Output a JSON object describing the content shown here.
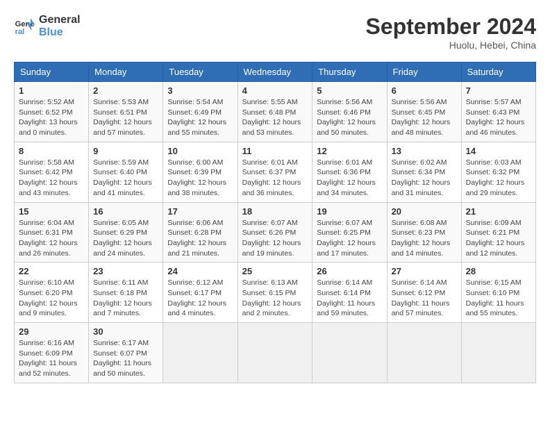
{
  "header": {
    "logo_line1": "General",
    "logo_line2": "Blue",
    "month": "September 2024",
    "location": "Huolu, Hebei, China"
  },
  "weekdays": [
    "Sunday",
    "Monday",
    "Tuesday",
    "Wednesday",
    "Thursday",
    "Friday",
    "Saturday"
  ],
  "weeks": [
    [
      {
        "day": "1",
        "detail": "Sunrise: 5:52 AM\nSunset: 6:52 PM\nDaylight: 13 hours\nand 0 minutes."
      },
      {
        "day": "2",
        "detail": "Sunrise: 5:53 AM\nSunset: 6:51 PM\nDaylight: 12 hours\nand 57 minutes."
      },
      {
        "day": "3",
        "detail": "Sunrise: 5:54 AM\nSunset: 6:49 PM\nDaylight: 12 hours\nand 55 minutes."
      },
      {
        "day": "4",
        "detail": "Sunrise: 5:55 AM\nSunset: 6:48 PM\nDaylight: 12 hours\nand 53 minutes."
      },
      {
        "day": "5",
        "detail": "Sunrise: 5:56 AM\nSunset: 6:46 PM\nDaylight: 12 hours\nand 50 minutes."
      },
      {
        "day": "6",
        "detail": "Sunrise: 5:56 AM\nSunset: 6:45 PM\nDaylight: 12 hours\nand 48 minutes."
      },
      {
        "day": "7",
        "detail": "Sunrise: 5:57 AM\nSunset: 6:43 PM\nDaylight: 12 hours\nand 46 minutes."
      }
    ],
    [
      {
        "day": "8",
        "detail": "Sunrise: 5:58 AM\nSunset: 6:42 PM\nDaylight: 12 hours\nand 43 minutes."
      },
      {
        "day": "9",
        "detail": "Sunrise: 5:59 AM\nSunset: 6:40 PM\nDaylight: 12 hours\nand 41 minutes."
      },
      {
        "day": "10",
        "detail": "Sunrise: 6:00 AM\nSunset: 6:39 PM\nDaylight: 12 hours\nand 38 minutes."
      },
      {
        "day": "11",
        "detail": "Sunrise: 6:01 AM\nSunset: 6:37 PM\nDaylight: 12 hours\nand 36 minutes."
      },
      {
        "day": "12",
        "detail": "Sunrise: 6:01 AM\nSunset: 6:36 PM\nDaylight: 12 hours\nand 34 minutes."
      },
      {
        "day": "13",
        "detail": "Sunrise: 6:02 AM\nSunset: 6:34 PM\nDaylight: 12 hours\nand 31 minutes."
      },
      {
        "day": "14",
        "detail": "Sunrise: 6:03 AM\nSunset: 6:32 PM\nDaylight: 12 hours\nand 29 minutes."
      }
    ],
    [
      {
        "day": "15",
        "detail": "Sunrise: 6:04 AM\nSunset: 6:31 PM\nDaylight: 12 hours\nand 26 minutes."
      },
      {
        "day": "16",
        "detail": "Sunrise: 6:05 AM\nSunset: 6:29 PM\nDaylight: 12 hours\nand 24 minutes."
      },
      {
        "day": "17",
        "detail": "Sunrise: 6:06 AM\nSunset: 6:28 PM\nDaylight: 12 hours\nand 21 minutes."
      },
      {
        "day": "18",
        "detail": "Sunrise: 6:07 AM\nSunset: 6:26 PM\nDaylight: 12 hours\nand 19 minutes."
      },
      {
        "day": "19",
        "detail": "Sunrise: 6:07 AM\nSunset: 6:25 PM\nDaylight: 12 hours\nand 17 minutes."
      },
      {
        "day": "20",
        "detail": "Sunrise: 6:08 AM\nSunset: 6:23 PM\nDaylight: 12 hours\nand 14 minutes."
      },
      {
        "day": "21",
        "detail": "Sunrise: 6:09 AM\nSunset: 6:21 PM\nDaylight: 12 hours\nand 12 minutes."
      }
    ],
    [
      {
        "day": "22",
        "detail": "Sunrise: 6:10 AM\nSunset: 6:20 PM\nDaylight: 12 hours\nand 9 minutes."
      },
      {
        "day": "23",
        "detail": "Sunrise: 6:11 AM\nSunset: 6:18 PM\nDaylight: 12 hours\nand 7 minutes."
      },
      {
        "day": "24",
        "detail": "Sunrise: 6:12 AM\nSunset: 6:17 PM\nDaylight: 12 hours\nand 4 minutes."
      },
      {
        "day": "25",
        "detail": "Sunrise: 6:13 AM\nSunset: 6:15 PM\nDaylight: 12 hours\nand 2 minutes."
      },
      {
        "day": "26",
        "detail": "Sunrise: 6:14 AM\nSunset: 6:14 PM\nDaylight: 11 hours\nand 59 minutes."
      },
      {
        "day": "27",
        "detail": "Sunrise: 6:14 AM\nSunset: 6:12 PM\nDaylight: 11 hours\nand 57 minutes."
      },
      {
        "day": "28",
        "detail": "Sunrise: 6:15 AM\nSunset: 6:10 PM\nDaylight: 11 hours\nand 55 minutes."
      }
    ],
    [
      {
        "day": "29",
        "detail": "Sunrise: 6:16 AM\nSunset: 6:09 PM\nDaylight: 11 hours\nand 52 minutes."
      },
      {
        "day": "30",
        "detail": "Sunrise: 6:17 AM\nSunset: 6:07 PM\nDaylight: 11 hours\nand 50 minutes."
      },
      {
        "day": "",
        "detail": ""
      },
      {
        "day": "",
        "detail": ""
      },
      {
        "day": "",
        "detail": ""
      },
      {
        "day": "",
        "detail": ""
      },
      {
        "day": "",
        "detail": ""
      }
    ]
  ]
}
